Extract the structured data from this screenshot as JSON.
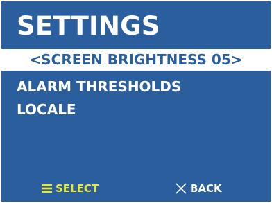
{
  "screen": {
    "title": "SETTINGS"
  },
  "menu": {
    "items": [
      {
        "label": "<SCREEN BRIGHTNESS 05>",
        "selected": true
      },
      {
        "label": "ALARM THRESHOLDS",
        "selected": false
      },
      {
        "label": "LOCALE",
        "selected": false
      }
    ]
  },
  "softkeys": {
    "select": {
      "label": "SELECT",
      "icon": "menu-icon"
    },
    "back": {
      "label": "BACK",
      "icon": "close-icon"
    }
  },
  "colors": {
    "background": "#2a5e9c",
    "text": "#ffffff",
    "selection_bg": "#ffffff",
    "selection_text": "#2a5e9c",
    "select_softkey": "#e8e83a"
  }
}
